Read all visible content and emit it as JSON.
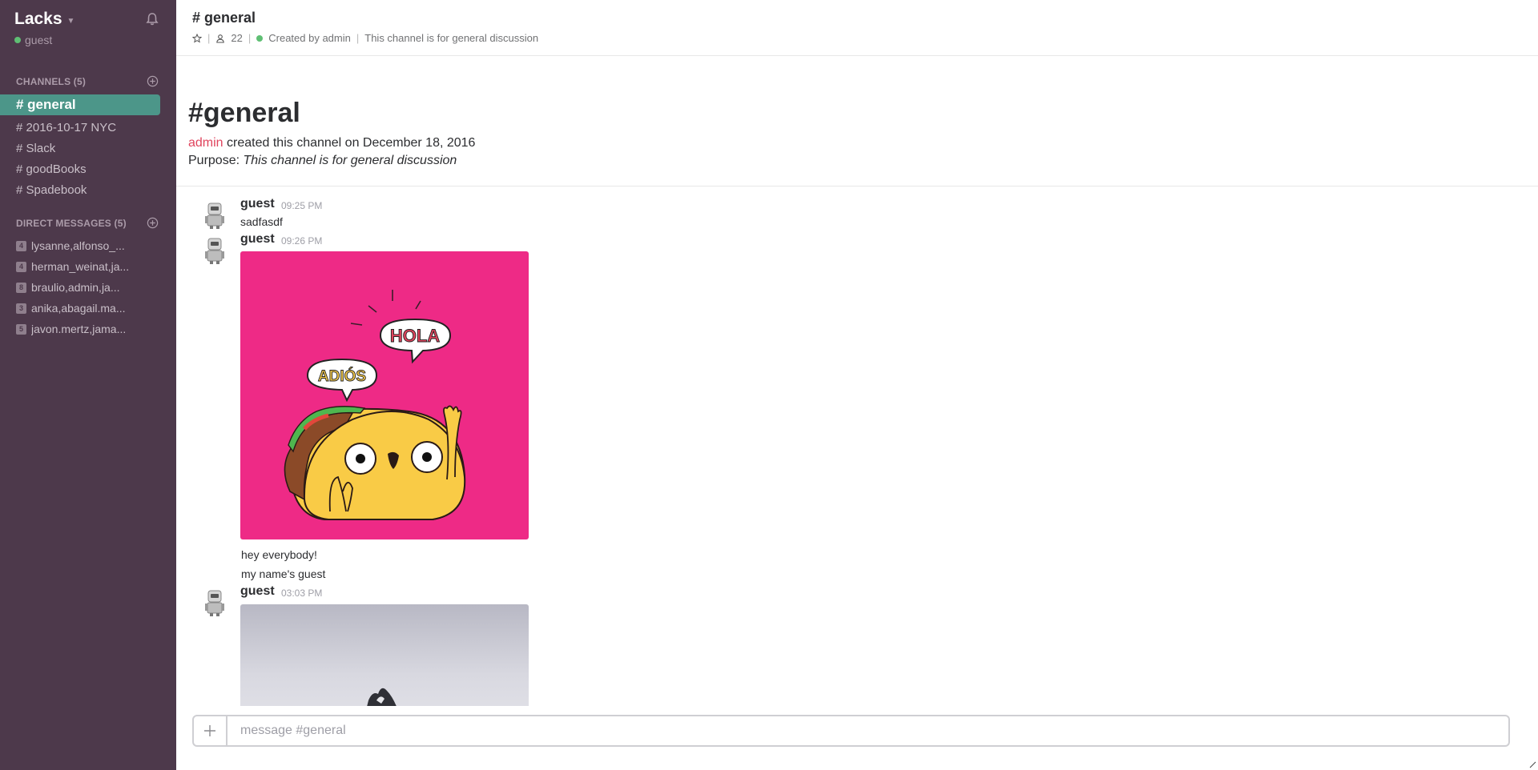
{
  "team": {
    "name": "Lacks",
    "user": "guest"
  },
  "sidebar": {
    "channels_header": "CHANNELS (5)",
    "channels": [
      {
        "label": "# general",
        "active": true
      },
      {
        "label": "# 2016-10-17 NYC"
      },
      {
        "label": "# Slack"
      },
      {
        "label": "# goodBooks"
      },
      {
        "label": "# Spadebook"
      }
    ],
    "dms_header": "DIRECT MESSAGES (5)",
    "dms": [
      {
        "count": "4",
        "name": "lysanne,alfonso_..."
      },
      {
        "count": "4",
        "name": "herman_weinat,ja..."
      },
      {
        "count": "8",
        "name": "braulio,admin,ja..."
      },
      {
        "count": "3",
        "name": "anika,abagail.ma..."
      },
      {
        "count": "5",
        "name": "javon.mertz,jama..."
      }
    ]
  },
  "header": {
    "title": "# general",
    "members": "22",
    "created_by": "Created by admin",
    "purpose": "This channel is for general discussion",
    "sep": "|"
  },
  "intro": {
    "title": "#general",
    "creator": "admin",
    "created_text": "created this channel on December 18, 2016",
    "purpose_label": "Purpose:",
    "purpose_text": "This channel is for general discussion"
  },
  "messages": [
    {
      "author": "guest",
      "time": "09:25 PM",
      "text": "sadfasdf"
    },
    {
      "author": "guest",
      "time": "09:26 PM",
      "image_text": [
        "HOLA",
        "ADIÓS"
      ],
      "lines": [
        "hey everybody!",
        "my name's guest"
      ]
    },
    {
      "author": "guest",
      "time": "03:03 PM"
    }
  ],
  "composer": {
    "placeholder": "message #general"
  },
  "colors": {
    "sidebar": "#4d394b",
    "active_channel": "#4c9689",
    "presence": "#5fbf74",
    "admin_link": "#e0445d",
    "taco_bg": "#ee2a86"
  }
}
